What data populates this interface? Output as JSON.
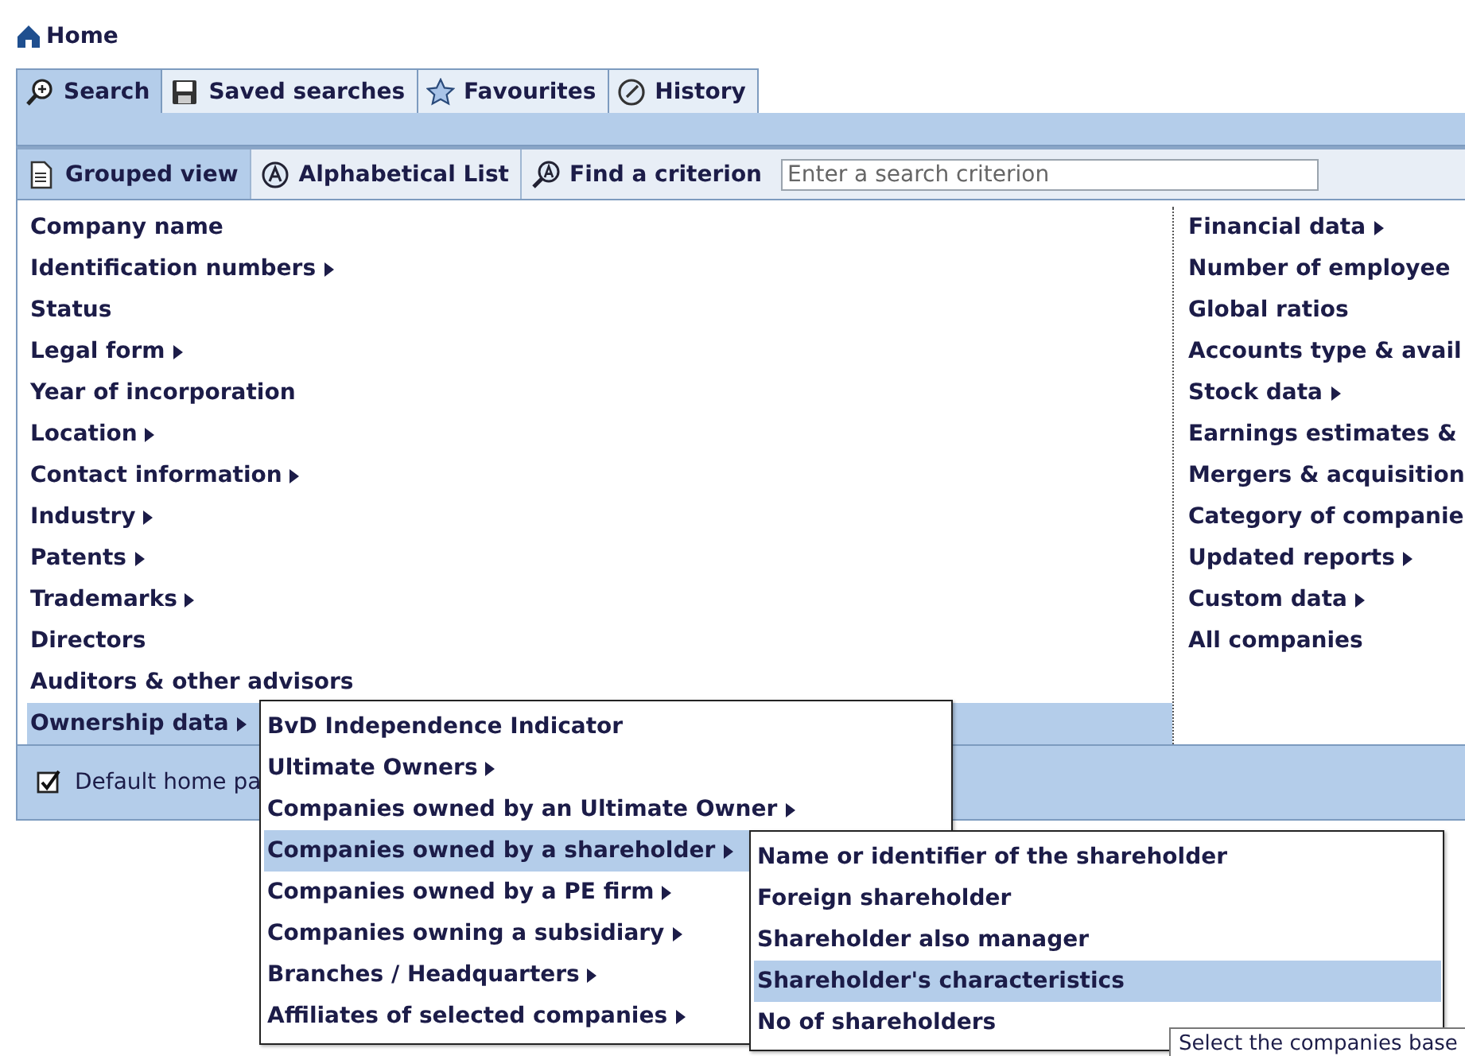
{
  "breadcrumb": {
    "label": "Home"
  },
  "tabs": [
    {
      "label": "Search",
      "selected": true
    },
    {
      "label": "Saved searches",
      "selected": false
    },
    {
      "label": "Favourites",
      "selected": false
    },
    {
      "label": "History",
      "selected": false
    }
  ],
  "view_tabs": [
    {
      "label": "Grouped view",
      "selected": true
    },
    {
      "label": "Alphabetical List",
      "selected": false
    }
  ],
  "find": {
    "label": "Find a criterion",
    "placeholder": "Enter a search criterion"
  },
  "criteria_left": [
    {
      "label": "Company name",
      "has_submenu": false,
      "selected": false
    },
    {
      "label": "Identification numbers",
      "has_submenu": true,
      "selected": false
    },
    {
      "label": "Status",
      "has_submenu": false,
      "selected": false
    },
    {
      "label": "Legal form",
      "has_submenu": true,
      "selected": false
    },
    {
      "label": "Year of incorporation",
      "has_submenu": false,
      "selected": false
    },
    {
      "label": "Location",
      "has_submenu": true,
      "selected": false
    },
    {
      "label": "Contact information",
      "has_submenu": true,
      "selected": false
    },
    {
      "label": "Industry",
      "has_submenu": true,
      "selected": false
    },
    {
      "label": "Patents",
      "has_submenu": true,
      "selected": false
    },
    {
      "label": "Trademarks",
      "has_submenu": true,
      "selected": false
    },
    {
      "label": "Directors",
      "has_submenu": false,
      "selected": false
    },
    {
      "label": "Auditors & other advisors",
      "has_submenu": false,
      "selected": false
    },
    {
      "label": "Ownership data",
      "has_submenu": true,
      "selected": true
    }
  ],
  "criteria_right": [
    {
      "label": "Financial data",
      "has_submenu": true,
      "selected": false
    },
    {
      "label": "Number of employee",
      "has_submenu": false,
      "selected": false
    },
    {
      "label": "Global ratios",
      "has_submenu": false,
      "selected": false
    },
    {
      "label": "Accounts type & avail",
      "has_submenu": false,
      "selected": false
    },
    {
      "label": "Stock data",
      "has_submenu": true,
      "selected": false
    },
    {
      "label": "Earnings estimates &",
      "has_submenu": false,
      "selected": false
    },
    {
      "label": "Mergers & acquisition",
      "has_submenu": false,
      "selected": false
    },
    {
      "label": "Category of companie",
      "has_submenu": false,
      "selected": false
    },
    {
      "label": "Updated reports",
      "has_submenu": true,
      "selected": false
    },
    {
      "label": "Custom data",
      "has_submenu": true,
      "selected": false
    },
    {
      "label": "All companies",
      "has_submenu": false,
      "selected": false
    }
  ],
  "footer": {
    "checked": true,
    "label": "Default home pa"
  },
  "menu": [
    {
      "label": "BvD Independence Indicator",
      "has_submenu": false,
      "selected": false
    },
    {
      "label": "Ultimate Owners",
      "has_submenu": true,
      "selected": false
    },
    {
      "label": "Companies owned by an Ultimate Owner",
      "has_submenu": true,
      "selected": false
    },
    {
      "label": "Companies owned by a shareholder",
      "has_submenu": true,
      "selected": true
    },
    {
      "label": "Companies owned by a PE firm",
      "has_submenu": true,
      "selected": false
    },
    {
      "label": "Companies owning a subsidiary",
      "has_submenu": true,
      "selected": false
    },
    {
      "label": "Branches / Headquarters",
      "has_submenu": true,
      "selected": false
    },
    {
      "label": "Affiliates of selected companies",
      "has_submenu": true,
      "selected": false
    }
  ],
  "submenu": [
    {
      "label": "Name or identifier of the shareholder",
      "selected": false
    },
    {
      "label": "Foreign shareholder",
      "selected": false
    },
    {
      "label": "Shareholder also manager",
      "selected": false
    },
    {
      "label": "Shareholder's characteristics",
      "selected": true
    },
    {
      "label": "No of shareholders",
      "selected": false
    }
  ],
  "tooltip": {
    "text": "Select the companies base"
  }
}
